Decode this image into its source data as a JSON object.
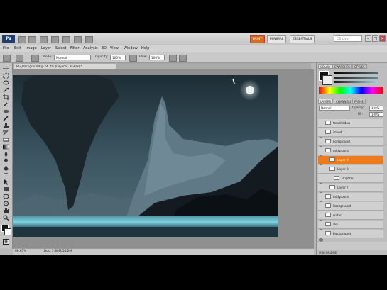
{
  "app": {
    "logo": "Ps",
    "workspaces": [
      "PAINT",
      "MINIMAL",
      "ESSENTIALS"
    ],
    "active_workspace": "PAINT",
    "search_placeholder": "CS Live"
  },
  "menu": [
    "File",
    "Edit",
    "Image",
    "Layer",
    "Select",
    "Filter",
    "Analysis",
    "3D",
    "View",
    "Window",
    "Help"
  ],
  "options": {
    "mode_label": "Mode:",
    "mode_value": "Normal",
    "opacity_label": "Opacity:",
    "opacity_value": "100%",
    "flow_label": "Flow:",
    "flow_value": "100%"
  },
  "document": {
    "tab_title": "BG_Background @ 66.7% (Layer 9, RGB/8) *",
    "zoom": "66.67%",
    "doc_size": "Doc: 2.88M/54.2M"
  },
  "panels": {
    "top_tabs": [
      "COLOR",
      "SWATCHES",
      "STYLES"
    ],
    "layer_tabs": [
      "LAYERS",
      "CHANNELS",
      "PATHS"
    ],
    "blend_mode": "Normal",
    "opacity_label": "Opacity:",
    "opacity_value": "100%",
    "fill_label": "Fill:",
    "fill_value": "100%",
    "bottom_label": "MINI BRIDGE",
    "layers": [
      {
        "name": "foreshadow",
        "indent": 0,
        "selected": false
      },
      {
        "name": "island",
        "indent": 0,
        "selected": false
      },
      {
        "name": "Foreground",
        "indent": 0,
        "selected": false
      },
      {
        "name": "midground",
        "indent": 0,
        "selected": false
      },
      {
        "name": "Layer 9",
        "indent": 1,
        "selected": true
      },
      {
        "name": "Layer 8",
        "indent": 1,
        "selected": false
      },
      {
        "name": "Brighter",
        "indent": 2,
        "selected": false
      },
      {
        "name": "Layer 7",
        "indent": 1,
        "selected": false
      },
      {
        "name": "midground",
        "indent": 0,
        "selected": false
      },
      {
        "name": "Background",
        "indent": 0,
        "selected": false
      },
      {
        "name": "water",
        "indent": 0,
        "selected": false
      },
      {
        "name": "sky",
        "indent": 0,
        "selected": false
      },
      {
        "name": "Background",
        "indent": 0,
        "selected": false
      }
    ]
  },
  "colors": {
    "accent": "#ef7a1a",
    "chrome": "#bdbdbd",
    "sky_dark": "#1a2a33",
    "sky_mid": "#3a5a66",
    "water": "#6fc6d6"
  }
}
